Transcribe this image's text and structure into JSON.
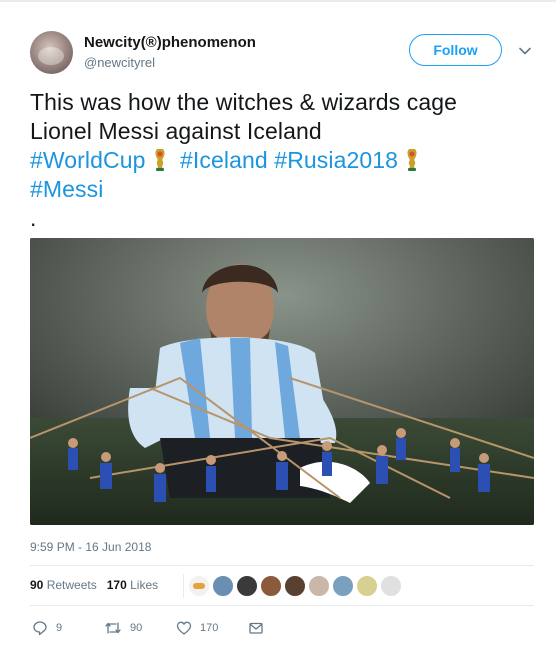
{
  "user": {
    "display_name": "Newcity(®)phenomenon",
    "handle": "@newcityrel",
    "follow_label": "Follow"
  },
  "tweet": {
    "line1": "This was how the witches & wizards cage",
    "line2": "Lionel Messi against Iceland",
    "hashtag_worldcup": "#WorldCup",
    "hashtag_iceland": "#Iceland",
    "hashtag_rusia": "#Rusia2018",
    "hashtag_messi": "#Messi",
    "trailing": ".",
    "timestamp": "9:59 PM - 16 Jun 2018"
  },
  "stats": {
    "retweets_count": "90",
    "retweets_label": "Retweets",
    "likes_count": "170",
    "likes_label": "Likes"
  },
  "actions": {
    "reply_count": "9",
    "retweet_count": "90",
    "like_count": "170"
  },
  "icons": {
    "more": "chevron-down-icon",
    "reply": "reply-icon",
    "retweet": "retweet-icon",
    "like": "heart-icon",
    "dm": "envelope-icon",
    "hashflag": "world-cup-trophy-icon"
  },
  "colors": {
    "accent": "#1da1f2",
    "hashtag": "#1b95e0",
    "muted": "#657786",
    "text": "#14171a"
  }
}
